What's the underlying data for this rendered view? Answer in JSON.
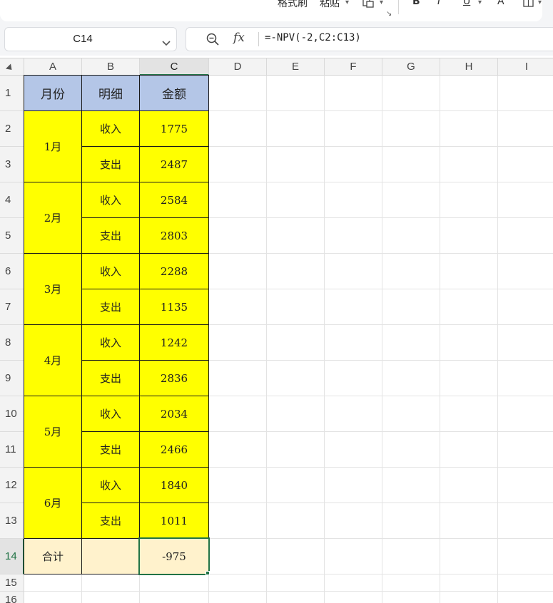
{
  "ribbon": {
    "format_painter": "格式刷",
    "paste": "粘贴",
    "bold": "B",
    "italic": "I",
    "underline": "U",
    "strike": "A"
  },
  "formula_bar": {
    "name_box": "C14",
    "fx_label": "fx",
    "formula": "=-NPV(-2,C2:C13)"
  },
  "columns": [
    "A",
    "B",
    "C",
    "D",
    "E",
    "F",
    "G",
    "H",
    "I"
  ],
  "rows": [
    "1",
    "2",
    "3",
    "4",
    "5",
    "6",
    "7",
    "8",
    "9",
    "10",
    "11",
    "12",
    "13",
    "14",
    "15",
    "16"
  ],
  "table": {
    "headers": [
      "月份",
      "明细",
      "金额"
    ],
    "months": [
      "1月",
      "2月",
      "3月",
      "4月",
      "5月",
      "6月"
    ],
    "details": [
      "收入",
      "支出",
      "收入",
      "支出",
      "收入",
      "支出",
      "收入",
      "支出",
      "收入",
      "支出",
      "收入",
      "支出"
    ],
    "amounts": [
      "1775",
      "2487",
      "2584",
      "2803",
      "2288",
      "1135",
      "1242",
      "2836",
      "2034",
      "2466",
      "1840",
      "1011"
    ],
    "total_label": "合计",
    "total_detail": "",
    "total_value": "-975"
  },
  "colors": {
    "header_fill": "#b4c6e7",
    "body_fill": "#ffff00",
    "total_fill": "#fff2cc",
    "selection": "#217346"
  }
}
